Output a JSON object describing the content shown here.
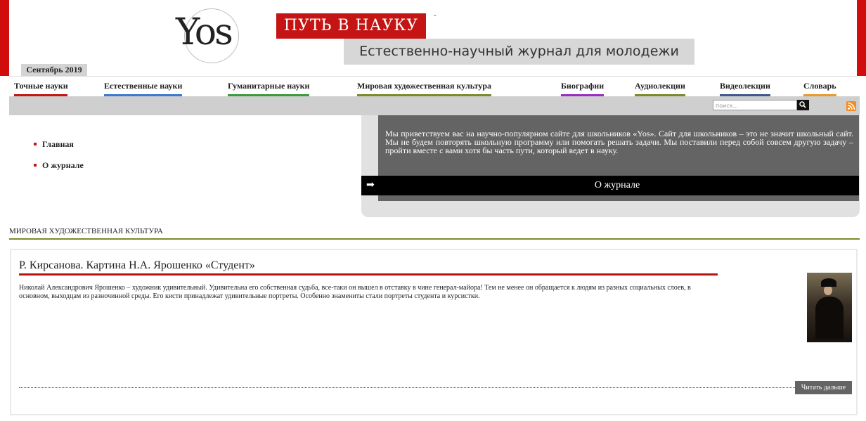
{
  "header": {
    "logo_text": "Yos",
    "ribbon": "ПУТЬ В НАУКУ",
    "dash": "-",
    "subtitle": "Естественно-научный журнал для молодежи",
    "issue": "Сентябрь 2019"
  },
  "colors": {
    "brand_red": "#c41414",
    "gray_band": "#cfcfcf",
    "section_olive": "#7b8a2a"
  },
  "nav": [
    {
      "label": "Точные науки",
      "color": "#c41414"
    },
    {
      "label": "Естественные науки",
      "color": "#3c7ad1"
    },
    {
      "label": "Гуманитарные науки",
      "color": "#3c9a3c"
    },
    {
      "label": "Мировая художественная культура",
      "color": "#7b8a2a"
    },
    {
      "label": "Биографии",
      "color": "#9b2bc4"
    },
    {
      "label": "Аудиолекции",
      "color": "#7b8a2a"
    },
    {
      "label": "Видеолекции",
      "color": "#3d5a8a"
    },
    {
      "label": "Словарь",
      "color": "#e89a2a"
    }
  ],
  "search": {
    "placeholder": "поиск...",
    "button_icon": "search-icon",
    "rss_icon": "rss-icon"
  },
  "menu": [
    {
      "label": "Главная"
    },
    {
      "label": "О журнале"
    }
  ],
  "featured": {
    "text": "Мы приветствуем вас на научно-популярном сайте для школьников «Yos». Сайт для школьников – это не значит школьный сайт. Мы не будем повторять школьную программу или помогать решать задачи. Мы поставили перед собой совсем другую задачу – пройти вместе с вами хотя бы часть пути, который ведет в науку.",
    "arrow": "➡",
    "bar_label": "О журнале"
  },
  "section": {
    "title": "МИРОВАЯ ХУДОЖЕСТВЕННАЯ КУЛЬТУРА",
    "article": {
      "title": "Р. Кирсанова. Картина Н.А. Ярошенко «Студент»",
      "body": "Николай Александрович Ярошенко – художник удивительный. Удивительна его собственная судьба, все-таки он вышел в отставку в чине генерал-майора!  Тем не менее он обращается к людям из разных социальных слоев, в основном, выходцам из разночинной среды. Его кисти принадлежат удивительные портреты. Особенно знамениты стали портреты студента и курсистки.",
      "read_more": "Читать дальше"
    }
  }
}
